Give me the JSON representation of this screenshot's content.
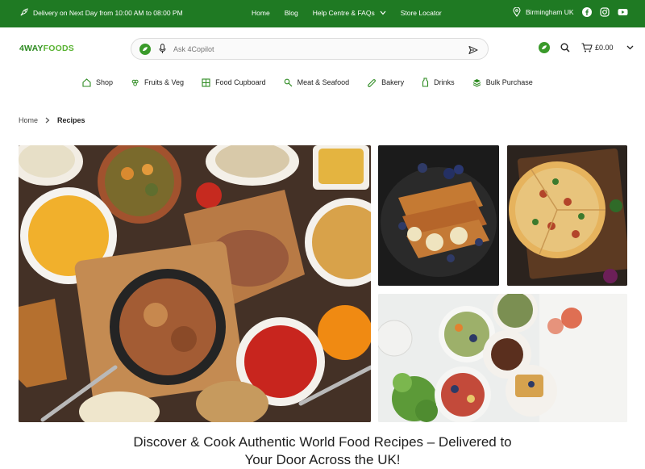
{
  "topbar": {
    "delivery_text": "Delivery on Next Day from 10:00 AM to 08:00 PM",
    "nav": [
      "Home",
      "Blog",
      "Help Centre & FAQs",
      "Store Locator"
    ],
    "location": "Birmingham UK",
    "bg_color": "#1f7a23"
  },
  "header": {
    "logo_four": "4WAY",
    "logo_rest": "FOODS",
    "search_placeholder": "Ask 4Copilot",
    "cart_amount": "£0.00"
  },
  "categories": [
    "Shop",
    "Fruits & Veg",
    "Food Cupboard",
    "Meat & Seafood",
    "Bakery",
    "Drinks",
    "Bulk Purchase"
  ],
  "breadcrumb": {
    "home": "Home",
    "current": "Recipes"
  },
  "hero": {
    "headline_line1": "Discover & Cook Authentic World Food Recipes – Delivered to",
    "headline_line2": "Your Door Across the UK!"
  }
}
